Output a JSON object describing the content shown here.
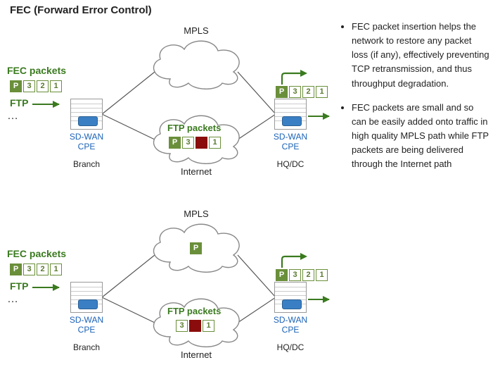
{
  "title": "FEC (Forward Error Control)",
  "bullets": [
    "FEC packet insertion helps the network to restore any packet loss (if any), effectively preventing TCP retransmission, and thus throughput degradation.",
    "FEC packets are small and so can be easily added onto traffic in high quality MPLS path while FTP packets are being delivered through the Internet path"
  ],
  "labels": {
    "mpls": "MPLS",
    "internet": "Internet",
    "branch": "Branch",
    "hqdc": "HQ/DC",
    "sdwan_cpe": "SD-WAN CPE",
    "fec_packets": "FEC packets",
    "ftp": "FTP",
    "ftp_packets": "FTP packets",
    "dots": "…"
  },
  "packets": {
    "source_row": [
      "P",
      "3",
      "2",
      "1"
    ],
    "dest_row_d1": [
      "P",
      "3",
      "2",
      "1"
    ],
    "dest_row_d2": [
      "P",
      "3",
      "2",
      "1"
    ],
    "internet_row_d1": [
      "P",
      "3",
      "LOST",
      "1"
    ],
    "internet_row_d2": [
      "3",
      "LOST",
      "1"
    ],
    "mpls_row_d2": [
      "P"
    ]
  }
}
